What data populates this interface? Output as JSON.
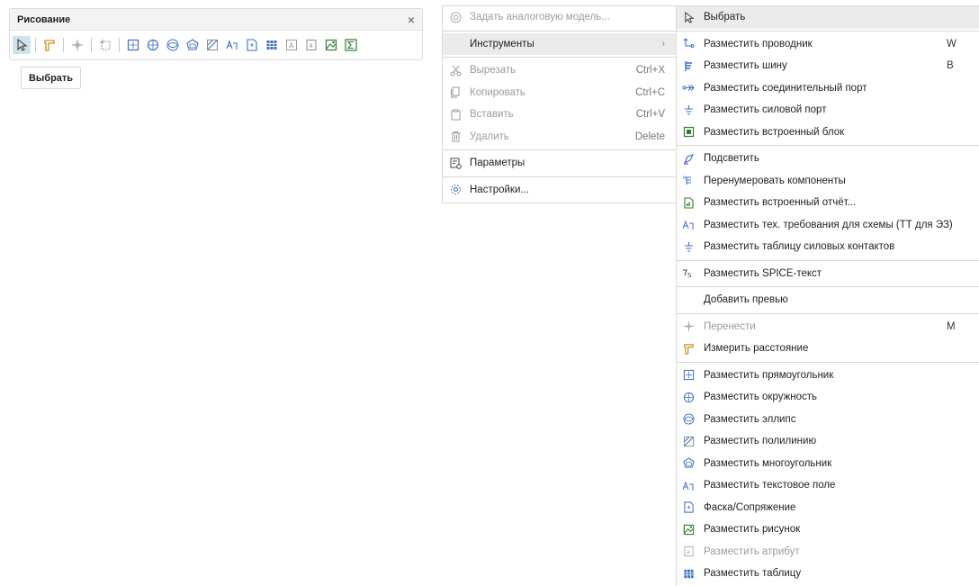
{
  "panel": {
    "title": "Рисование",
    "close": "×",
    "tools": [
      "cursor-icon",
      "measure-icon",
      "move-icon",
      "region-icon",
      "rectangle-icon",
      "circle-icon",
      "ellipse-icon",
      "polygon-icon",
      "polyline-icon",
      "text-icon",
      "chamfer-icon",
      "table-icon",
      "attribute-icon",
      "textfield-icon",
      "picture-icon",
      "sum-icon"
    ]
  },
  "tooltip": "Выбрать",
  "menu1": {
    "analog": "Задать аналоговую модель...",
    "tools": "Инструменты",
    "tools_arrow": "›",
    "cut": "Вырезать",
    "cut_sc": "Ctrl+X",
    "copy": "Копировать",
    "copy_sc": "Ctrl+C",
    "paste": "Вставить",
    "paste_sc": "Ctrl+V",
    "delete": "Удалить",
    "delete_sc": "Delete",
    "params": "Параметры",
    "settings": "Настройки..."
  },
  "menu2": {
    "select": "Выбрать",
    "wire": "Разместить проводник",
    "wire_sc": "W",
    "bus": "Разместить шину",
    "bus_sc": "B",
    "port": "Разместить соединительный порт",
    "power": "Разместить силовой порт",
    "block": "Разместить встроенный блок",
    "highlight": "Подсветить",
    "renumber": "Перенумеровать компоненты",
    "report": "Разместить встроенный отчёт...",
    "tech": "Разместить тех. требования для схемы (ТТ для ЭЗ)",
    "power_table": "Разместить таблицу силовых контактов",
    "spice": "Разместить SPICE-текст",
    "preview": "Добавить превью",
    "move": "Перенести",
    "move_sc": "M",
    "measure": "Измерить расстояние",
    "rect": "Разместить прямоугольник",
    "circle": "Разместить окружность",
    "ellipse": "Разместить эллипс",
    "polyline": "Разместить полилинию",
    "polygon": "Разместить многоугольник",
    "textfield": "Разместить текстовое поле",
    "chamfer": "Фаска/Сопряжение",
    "picture": "Разместить рисунок",
    "attribute": "Разместить атрибут",
    "table": "Разместить таблицу"
  }
}
